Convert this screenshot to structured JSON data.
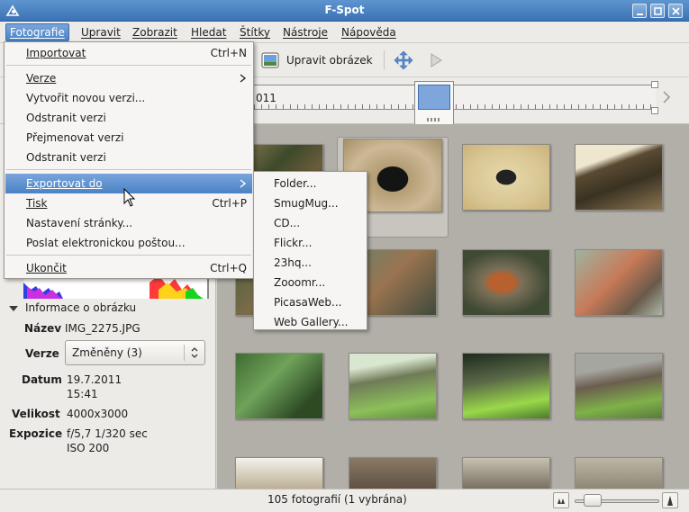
{
  "window": {
    "title": "F-Spot"
  },
  "menubar": {
    "items": [
      {
        "label": "Fotografie"
      },
      {
        "label": "Upravit"
      },
      {
        "label": "Zobrazit"
      },
      {
        "label": "Hledat"
      },
      {
        "label": "Štítky"
      },
      {
        "label": "Nástroje"
      },
      {
        "label": "Nápověda"
      }
    ]
  },
  "toolbar": {
    "edit_label": "Upravit obrázek"
  },
  "timeline": {
    "year_fragment": "011"
  },
  "photo_menu": {
    "items": [
      {
        "label": "Importovat",
        "accel": "Ctrl+N"
      },
      {
        "label": "Verze",
        "submenu": true
      },
      {
        "label": "Vytvořit novou verzi..."
      },
      {
        "label": "Odstranit verzi"
      },
      {
        "label": "Přejmenovat verzi"
      },
      {
        "label": "Odstranit verzi"
      },
      {
        "label": "Exportovat do",
        "submenu": true,
        "highlighted": true
      },
      {
        "label": "Tisk",
        "accel": "Ctrl+P"
      },
      {
        "label": "Nastavení stránky..."
      },
      {
        "label": "Poslat elektronickou poštou..."
      },
      {
        "label": "Ukončit",
        "accel": "Ctrl+Q"
      }
    ]
  },
  "export_submenu": {
    "items": [
      {
        "label": "Folder..."
      },
      {
        "label": "SmugMug..."
      },
      {
        "label": "CD..."
      },
      {
        "label": "Flickr..."
      },
      {
        "label": "23hq..."
      },
      {
        "label": "Zooomr..."
      },
      {
        "label": "PicasaWeb..."
      },
      {
        "label": "Web Gallery..."
      }
    ]
  },
  "info": {
    "header": "Informace o obrázku",
    "name_label": "Název",
    "name": "IMG_2275.JPG",
    "version_label": "Verze",
    "version": "Změněny (3)",
    "date_label": "Datum",
    "date": "19.7.2011",
    "time": "15:41",
    "size_label": "Velikost",
    "size": "4000x3000",
    "exposure_label": "Expozice",
    "exposure": "f/5,7 1/320 sec",
    "iso": "ISO 200"
  },
  "status": {
    "text": "105 fotografií (1 vybrána)"
  },
  "colors": {
    "selection": "#4a82c6",
    "titlebar": "#3b72b5",
    "grid_bg": "#b2afa9"
  }
}
